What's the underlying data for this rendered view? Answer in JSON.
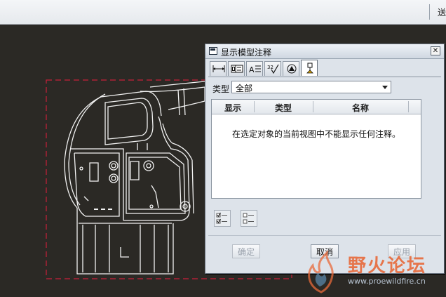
{
  "toolbar": {
    "fragment": "送"
  },
  "dialog": {
    "title": "显示模型注释",
    "close_glyph": "✕",
    "tabs": [
      {
        "icon": "dimension-icon",
        "active": false
      },
      {
        "icon": "geometric-tolerance-icon",
        "active": false
      },
      {
        "icon": "note-icon",
        "active": false
      },
      {
        "icon": "surface-finish-icon",
        "active": false
      },
      {
        "icon": "symbol-icon",
        "active": false
      },
      {
        "icon": "datum-icon",
        "active": true
      }
    ],
    "type_label": "类型",
    "type_value": "全部",
    "columns": [
      "显示",
      "类型",
      "名称"
    ],
    "empty_message": "在选定对象的当前视图中不能显示任何注释。",
    "select_all_icon": "select-all-icon",
    "deselect_all_icon": "deselect-all-icon",
    "buttons": {
      "ok": "确定",
      "cancel": "取消",
      "apply": "应用"
    }
  },
  "watermark": {
    "title": "野火论坛",
    "url": "www.proewildfire.cn"
  },
  "colors": {
    "canvas": "#2b2925",
    "drawing_lines": "#f2f2f2",
    "border_dash": "#c8203a",
    "dialog_bg": "#dde3ea"
  }
}
